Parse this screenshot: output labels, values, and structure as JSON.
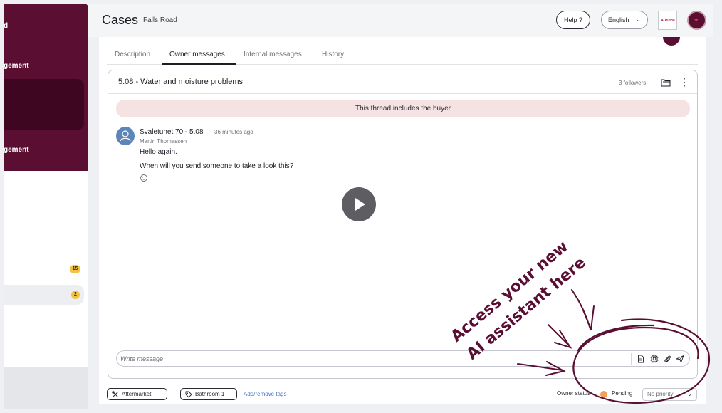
{
  "sidebar": {
    "items": [
      {
        "label": "d"
      },
      {
        "label": "gement"
      },
      {
        "label": "gement"
      }
    ],
    "badges": [
      "15",
      "2"
    ]
  },
  "header": {
    "title": "Cases",
    "subtitle": "Falls Road",
    "help_label": "Help ?",
    "language": "English",
    "logo_text": "✦ Ruthe"
  },
  "tabs": [
    {
      "label": "Description"
    },
    {
      "label": "Owner messages"
    },
    {
      "label": "Internal messages"
    },
    {
      "label": "History"
    }
  ],
  "thread": {
    "title": "5.08 - Water and moisture problems",
    "followers": "3 followers",
    "banner": "This thread includes the buyer",
    "message": {
      "sender": "Svaletunet 70 - 5.08",
      "time": "36 minutes ago",
      "author": "Martin Thomassen",
      "lines": [
        "Hello again.",
        "When will you send someone to take a look this?"
      ]
    },
    "composer_placeholder": "Write message"
  },
  "footer": {
    "tags": [
      "Aftermarket",
      "Bathroom 1"
    ],
    "add_tags": "Add/remove tags",
    "owner_status_label": "Owner status",
    "status": "Pending",
    "priority": "No priority"
  },
  "annotation": {
    "line1": "Access your new",
    "line2": "AI assistant here",
    "color": "#5a0e32"
  },
  "colors": {
    "brand": "#5a0e32",
    "brand_dark": "#3e0621",
    "badge": "#f2c343",
    "banner": "#f5e2e2",
    "pending": "#f0a05a",
    "link": "#3f72c4"
  }
}
